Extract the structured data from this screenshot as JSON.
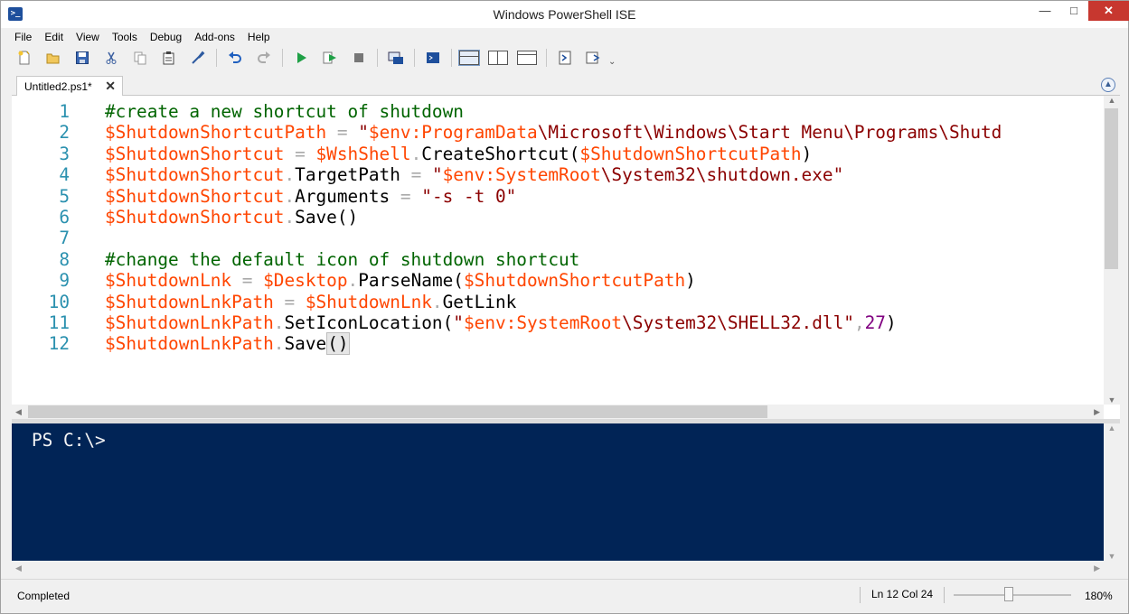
{
  "window": {
    "title": "Windows PowerShell ISE"
  },
  "menu": [
    "File",
    "Edit",
    "View",
    "Tools",
    "Debug",
    "Add-ons",
    "Help"
  ],
  "toolbar": {
    "buttons": [
      "new-icon",
      "open-icon",
      "save-icon",
      "cut-icon",
      "copy-icon",
      "paste-icon",
      "clear-pane-icon",
      "undo-icon",
      "redo-icon",
      "run-icon",
      "run-selection-icon",
      "stop-icon",
      "remote-powershell-icon",
      "console-icon",
      "layout-top-icon",
      "layout-right-icon",
      "layout-max-icon",
      "show-commands-icon",
      "show-addon-icon"
    ],
    "overflow": "⌄"
  },
  "tab": {
    "label": "Untitled2.ps1*",
    "close": "✕"
  },
  "editor": {
    "lines": [
      {
        "n": "1",
        "tokens": [
          {
            "t": "#create a new shortcut of shutdown",
            "c": "c-com"
          }
        ]
      },
      {
        "n": "2",
        "tokens": [
          {
            "t": "$ShutdownShortcutPath",
            "c": "c-var"
          },
          {
            "t": " = ",
            "c": "c-op"
          },
          {
            "t": "\"",
            "c": "c-str"
          },
          {
            "t": "$env:ProgramData",
            "c": "c-var"
          },
          {
            "t": "\\Microsoft\\Windows\\Start Menu\\Programs\\Shutd",
            "c": "c-str"
          }
        ]
      },
      {
        "n": "3",
        "tokens": [
          {
            "t": "$ShutdownShortcut",
            "c": "c-var"
          },
          {
            "t": " = ",
            "c": "c-op"
          },
          {
            "t": "$WshShell",
            "c": "c-var"
          },
          {
            "t": ".",
            "c": "c-op"
          },
          {
            "t": "CreateShortcut(",
            "c": "c-def"
          },
          {
            "t": "$ShutdownShortcutPath",
            "c": "c-var"
          },
          {
            "t": ")",
            "c": "c-def"
          }
        ]
      },
      {
        "n": "4",
        "tokens": [
          {
            "t": "$ShutdownShortcut",
            "c": "c-var"
          },
          {
            "t": ".",
            "c": "c-op"
          },
          {
            "t": "TargetPath",
            "c": "c-def"
          },
          {
            "t": " = ",
            "c": "c-op"
          },
          {
            "t": "\"",
            "c": "c-str"
          },
          {
            "t": "$env:SystemRoot",
            "c": "c-var"
          },
          {
            "t": "\\System32\\shutdown.exe\"",
            "c": "c-str"
          }
        ]
      },
      {
        "n": "5",
        "tokens": [
          {
            "t": "$ShutdownShortcut",
            "c": "c-var"
          },
          {
            "t": ".",
            "c": "c-op"
          },
          {
            "t": "Arguments",
            "c": "c-def"
          },
          {
            "t": " = ",
            "c": "c-op"
          },
          {
            "t": "\"-s -t 0\"",
            "c": "c-str"
          }
        ]
      },
      {
        "n": "6",
        "tokens": [
          {
            "t": "$ShutdownShortcut",
            "c": "c-var"
          },
          {
            "t": ".",
            "c": "c-op"
          },
          {
            "t": "Save()",
            "c": "c-def"
          }
        ]
      },
      {
        "n": "7",
        "tokens": []
      },
      {
        "n": "8",
        "tokens": [
          {
            "t": "#change the default icon of shutdown shortcut",
            "c": "c-com"
          }
        ]
      },
      {
        "n": "9",
        "tokens": [
          {
            "t": "$ShutdownLnk",
            "c": "c-var"
          },
          {
            "t": " = ",
            "c": "c-op"
          },
          {
            "t": "$Desktop",
            "c": "c-var"
          },
          {
            "t": ".",
            "c": "c-op"
          },
          {
            "t": "ParseName(",
            "c": "c-def"
          },
          {
            "t": "$ShutdownShortcutPath",
            "c": "c-var"
          },
          {
            "t": ")",
            "c": "c-def"
          }
        ]
      },
      {
        "n": "10",
        "tokens": [
          {
            "t": "$ShutdownLnkPath",
            "c": "c-var"
          },
          {
            "t": " = ",
            "c": "c-op"
          },
          {
            "t": "$ShutdownLnk",
            "c": "c-var"
          },
          {
            "t": ".",
            "c": "c-op"
          },
          {
            "t": "GetLink",
            "c": "c-def"
          }
        ]
      },
      {
        "n": "11",
        "tokens": [
          {
            "t": "$ShutdownLnkPath",
            "c": "c-var"
          },
          {
            "t": ".",
            "c": "c-op"
          },
          {
            "t": "SetIconLocation(",
            "c": "c-def"
          },
          {
            "t": "\"",
            "c": "c-str"
          },
          {
            "t": "$env:SystemRoot",
            "c": "c-var"
          },
          {
            "t": "\\System32\\SHELL32.dll\"",
            "c": "c-str"
          },
          {
            "t": ",",
            "c": "c-op"
          },
          {
            "t": "27",
            "c": "c-num"
          },
          {
            "t": ")",
            "c": "c-def"
          }
        ]
      },
      {
        "n": "12",
        "tokens": [
          {
            "t": "$ShutdownLnkPath",
            "c": "c-var"
          },
          {
            "t": ".",
            "c": "c-op"
          },
          {
            "t": "Save",
            "c": "c-def"
          },
          {
            "t": "()",
            "c": "c-def caret-box"
          }
        ]
      }
    ]
  },
  "console": {
    "prompt": "PS C:\\>"
  },
  "status": {
    "text": "Completed",
    "line_col": "Ln 12  Col 24",
    "zoom": "180%",
    "zoom_level": 0.47
  },
  "colors": {
    "console_bg": "#012456",
    "comment": "#006400",
    "variable": "#ff4500",
    "string": "#8b0000",
    "line_number": "#2b91af"
  }
}
